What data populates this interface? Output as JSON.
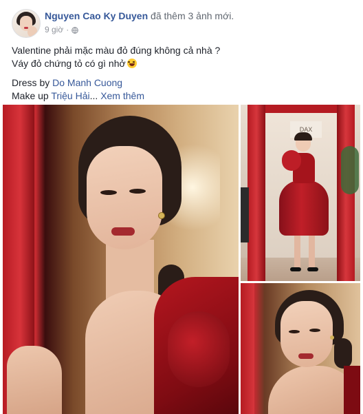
{
  "post": {
    "author": "Nguyen Cao Ky Duyen",
    "action": "đã thêm 3 ảnh mới.",
    "time": "9 giờ",
    "audience_icon": "globe-icon",
    "text_line1": "Valentine phải mặc màu đỏ đúng không cả nhà ?",
    "text_line2": "Váy đỏ chứng tỏ có gì nhở",
    "emoji": "grinning-squinting-face-emoji",
    "dress_label": "Dress by ",
    "dress_credit": "Do Manh Cuong",
    "makeup_label": "Make up ",
    "makeup_credit": "Triệu Hải",
    "ellipsis": "... ",
    "see_more": "Xem thêm"
  },
  "photos": {
    "sign_text": "DAX"
  },
  "colors": {
    "link": "#365899",
    "text": "#1d2129",
    "meta": "#90949c",
    "dress_red": "#b5161f"
  }
}
